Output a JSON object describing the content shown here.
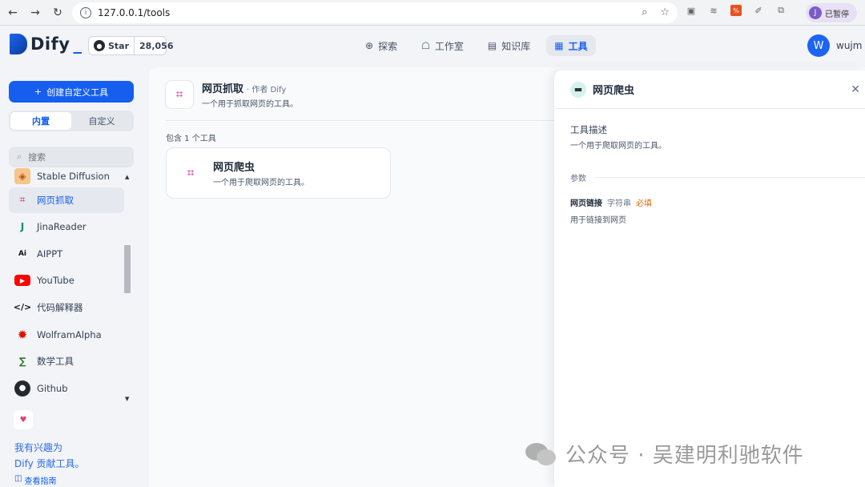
{
  "browser": {
    "url": "127.0.0.1/tools",
    "paused_avatar": "J",
    "paused_label": "已暂停"
  },
  "header": {
    "logo_text": "Dify",
    "github_star_label": "Star",
    "github_star_count": "28,056",
    "nav": [
      {
        "label": "探索",
        "icon": "compass-icon",
        "active": false
      },
      {
        "label": "工作室",
        "icon": "robot-icon",
        "active": false
      },
      {
        "label": "知识库",
        "icon": "book-icon",
        "active": false
      },
      {
        "label": "工具",
        "icon": "toolbox-icon",
        "active": true
      }
    ],
    "user_avatar": "W",
    "user_name": "wujm"
  },
  "sidebar": {
    "create_button": "创建自定义工具",
    "tabs": [
      {
        "label": "内置",
        "active": true
      },
      {
        "label": "自定义",
        "active": false
      }
    ],
    "search_placeholder": "搜索",
    "tools": [
      {
        "label": "Stable Diffusion",
        "icon": "stable-diffusion-icon"
      },
      {
        "label": "网页抓取",
        "icon": "webscraper-icon",
        "active": true
      },
      {
        "label": "JinaReader",
        "icon": "jina-icon"
      },
      {
        "label": "AIPPT",
        "icon": "aippt-icon"
      },
      {
        "label": "YouTube",
        "icon": "youtube-icon"
      },
      {
        "label": "代码解释器",
        "icon": "code-icon"
      },
      {
        "label": "WolframAlpha",
        "icon": "wolfram-icon"
      },
      {
        "label": "数学工具",
        "icon": "math-icon"
      },
      {
        "label": "Github",
        "icon": "github-icon"
      }
    ],
    "contribute_line1": "我有兴趣为",
    "contribute_line2": "Dify 贡献工具。",
    "guide_link": "查看指南"
  },
  "provider": {
    "title": "网页抓取",
    "author": "· 作者 Dify",
    "description": "一个用于抓取网页的工具。",
    "count_text": "包含 1 个工具"
  },
  "tool_card": {
    "title": "网页爬虫",
    "description": "一个用于爬取网页的工具。"
  },
  "drawer": {
    "title": "网页爬虫",
    "desc_label": "工具描述",
    "desc_text": "一个用于爬取网页的工具。",
    "params_label": "参数",
    "params": [
      {
        "name": "网页链接",
        "type": "字符串",
        "required": "必填",
        "description": "用于链接到网页"
      }
    ]
  },
  "watermark": {
    "text": "公众号 · 吴建明利驰软件"
  },
  "colors": {
    "accent": "#155eef",
    "required": "#dc6803",
    "scraper_brand": "#c9177e"
  }
}
